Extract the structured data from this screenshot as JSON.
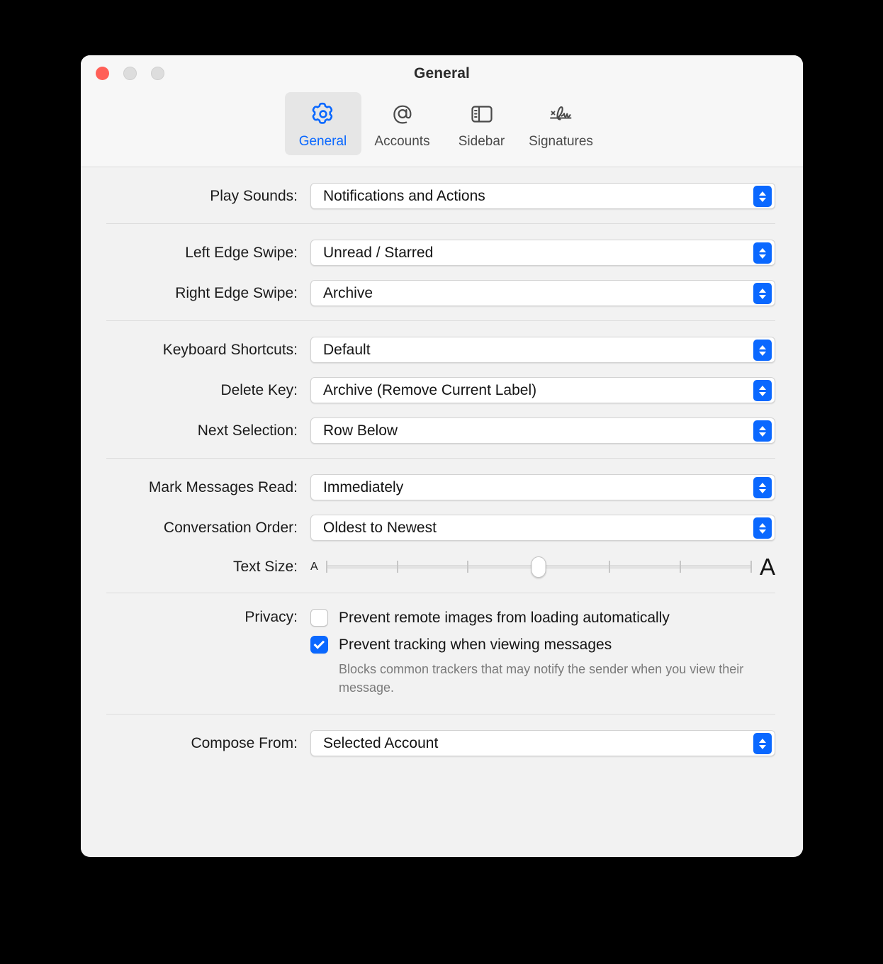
{
  "window": {
    "title": "General",
    "traffic_lights": [
      "close-button",
      "minimize-button",
      "maximize-button"
    ]
  },
  "toolbar": {
    "tabs": [
      {
        "label": "General",
        "icon": "gear-icon",
        "selected": true
      },
      {
        "label": "Accounts",
        "icon": "at-sign-icon",
        "selected": false
      },
      {
        "label": "Sidebar",
        "icon": "sidebar-icon",
        "selected": false
      },
      {
        "label": "Signatures",
        "icon": "signature-icon",
        "selected": false
      }
    ]
  },
  "settings": {
    "play_sounds": {
      "label": "Play Sounds:",
      "value": "Notifications and Actions"
    },
    "left_edge_swipe": {
      "label": "Left Edge Swipe:",
      "value": "Unread / Starred"
    },
    "right_edge_swipe": {
      "label": "Right Edge Swipe:",
      "value": "Archive"
    },
    "keyboard_shortcuts": {
      "label": "Keyboard Shortcuts:",
      "value": "Default"
    },
    "delete_key": {
      "label": "Delete Key:",
      "value": "Archive (Remove Current Label)"
    },
    "next_selection": {
      "label": "Next Selection:",
      "value": "Row Below"
    },
    "mark_messages_read": {
      "label": "Mark Messages Read:",
      "value": "Immediately"
    },
    "conversation_order": {
      "label": "Conversation Order:",
      "value": "Oldest to Newest"
    },
    "text_size": {
      "label": "Text Size:",
      "min_label": "A",
      "max_label": "A",
      "ticks": 7,
      "value": 4
    },
    "privacy": {
      "label": "Privacy:",
      "prevent_remote_images": {
        "text": "Prevent remote images from loading automatically",
        "checked": false
      },
      "prevent_tracking": {
        "text": "Prevent tracking when viewing messages",
        "checked": true,
        "hint": "Blocks common trackers that may notify the sender when you view their message."
      }
    },
    "compose_from": {
      "label": "Compose From:",
      "value": "Selected Account"
    }
  },
  "colors": {
    "accent": "#0a68ff",
    "close": "#ff5f57",
    "window_bg": "#f2f2f2",
    "titlebar_bg": "#f7f7f7"
  }
}
